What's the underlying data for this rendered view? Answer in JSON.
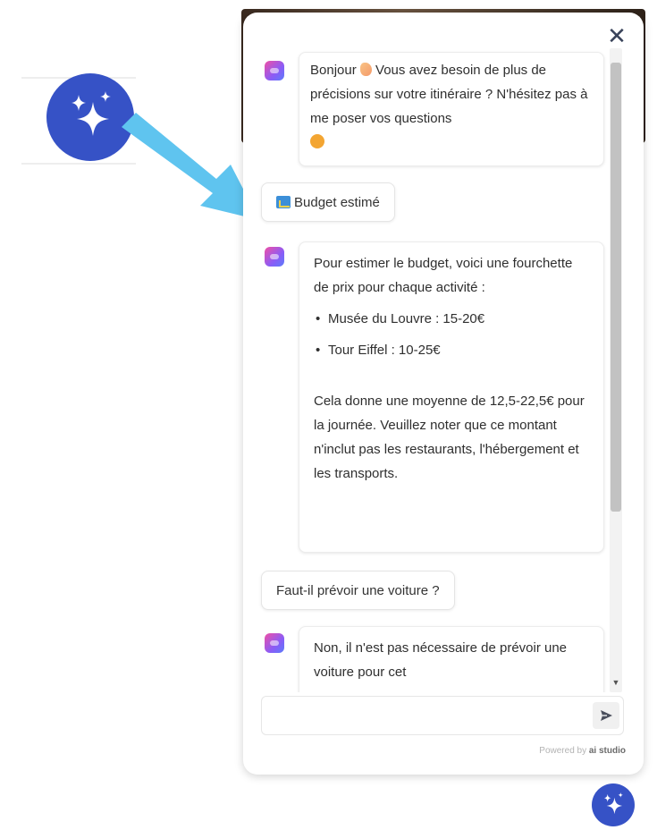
{
  "chat": {
    "messages": [
      {
        "role": "bot",
        "text_before_emoji": "Bonjour ",
        "emoji": "waving-hand-icon",
        "text_after_emoji": " Vous avez besoin de plus de précisions sur votre itinéraire ? N'hésitez pas à me poser vos questions",
        "emoji_end": "smile-icon"
      },
      {
        "role": "user",
        "icon": "chart-icon",
        "text": "Budget estimé"
      },
      {
        "role": "bot",
        "intro": "Pour estimer le budget, voici une fourchette de prix pour chaque activité :",
        "bullets": [
          "Musée du Louvre : 15-20€",
          "Tour Eiffel : 10-25€"
        ],
        "outro": "Cela donne une moyenne de 12,5-22,5€ pour la journée. Veuillez noter que ce montant n'inclut pas les restaurants, l'hébergement et les transports."
      },
      {
        "role": "user",
        "text": "Faut-il prévoir une voiture ?"
      },
      {
        "role": "bot",
        "text": "Non, il n'est pas nécessaire de prévoir une voiture pour cet"
      }
    ]
  },
  "input": {
    "value": "",
    "placeholder": ""
  },
  "footer": {
    "powered_prefix": "Powered by ",
    "powered_brand": "ai studio"
  },
  "colors": {
    "accent": "#3652c6",
    "arrow": "#5fc4ef",
    "avatar_start": "#f04fa6",
    "avatar_end": "#5b7cfa"
  },
  "icons": {
    "close": "close-icon",
    "send": "send-icon",
    "launcher": "sparkles-icon",
    "promo": "sparkles-icon"
  }
}
